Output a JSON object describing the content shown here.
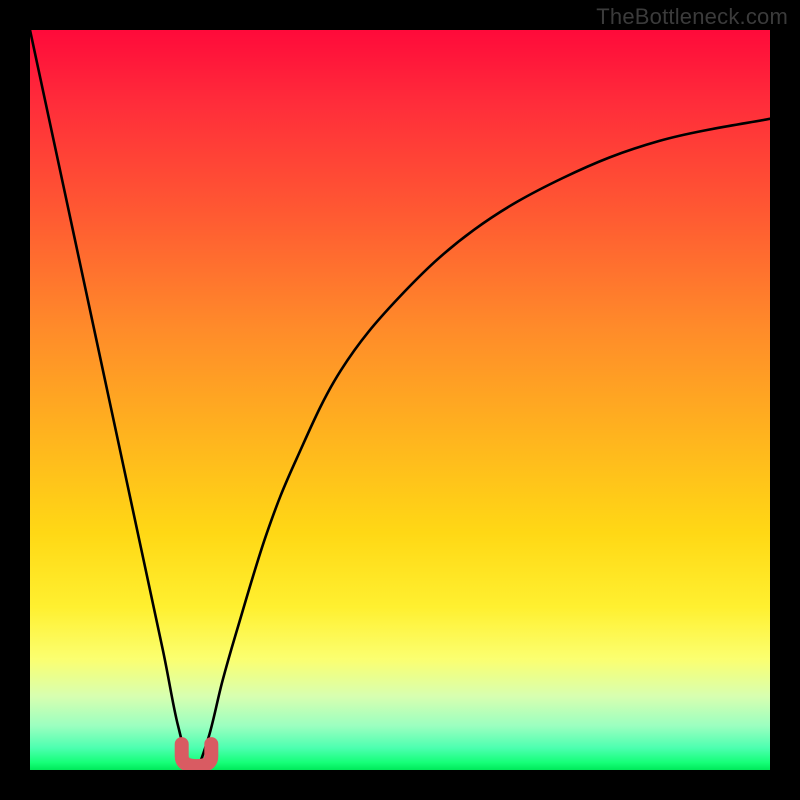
{
  "watermark": "TheBottleneck.com",
  "colors": {
    "frame": "#000000",
    "curve_stroke": "#000000",
    "marker": "#d95b62",
    "gradient_stops": [
      {
        "pos": 0.0,
        "hex": "#ff0a3a"
      },
      {
        "pos": 0.1,
        "hex": "#ff2d3a"
      },
      {
        "pos": 0.25,
        "hex": "#ff5a32"
      },
      {
        "pos": 0.4,
        "hex": "#ff8a2a"
      },
      {
        "pos": 0.55,
        "hex": "#ffb41e"
      },
      {
        "pos": 0.68,
        "hex": "#ffd815"
      },
      {
        "pos": 0.78,
        "hex": "#fff030"
      },
      {
        "pos": 0.85,
        "hex": "#fbff70"
      },
      {
        "pos": 0.9,
        "hex": "#d8ffb0"
      },
      {
        "pos": 0.94,
        "hex": "#9cffc0"
      },
      {
        "pos": 0.97,
        "hex": "#4dffb0"
      },
      {
        "pos": 0.99,
        "hex": "#15ff78"
      },
      {
        "pos": 1.0,
        "hex": "#00e85a"
      }
    ]
  },
  "chart_data": {
    "type": "line",
    "title": "",
    "xlabel": "",
    "ylabel": "",
    "xlim": [
      0,
      100
    ],
    "ylim": [
      0,
      100
    ],
    "note": "Bottleneck-style V curve. Lower y = better (green). Minimum near x≈22 where y≈0. Values are approximate percentages read from the image.",
    "series": [
      {
        "name": "bottleneck-curve",
        "x": [
          0,
          3,
          6,
          9,
          12,
          15,
          18,
          20,
          22,
          24,
          26,
          28,
          32,
          36,
          42,
          50,
          60,
          72,
          85,
          100
        ],
        "y": [
          100,
          86,
          72,
          58,
          44,
          30,
          16,
          6,
          0,
          4,
          12,
          19,
          32,
          42,
          54,
          64,
          73,
          80,
          85,
          88
        ]
      }
    ],
    "markers": [
      {
        "name": "optimal-left",
        "x": 20.5,
        "y": 3.5
      },
      {
        "name": "optimal-right",
        "x": 24.5,
        "y": 3.5
      }
    ]
  }
}
